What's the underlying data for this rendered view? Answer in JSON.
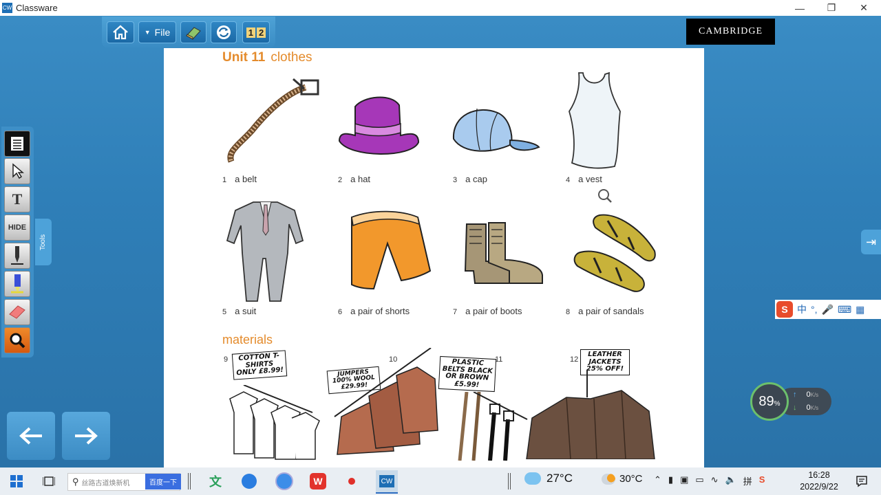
{
  "window": {
    "title": "Classware",
    "icon": "CW"
  },
  "toolbar": {
    "file_label": "File",
    "pages_label_1": "1",
    "pages_label_2": "2"
  },
  "brand": "CAMBRIDGE",
  "page": {
    "title_unit": "Unit 11",
    "title_topic": "clothes",
    "items": [
      {
        "num": "1",
        "label": "a belt"
      },
      {
        "num": "2",
        "label": "a hat"
      },
      {
        "num": "3",
        "label": "a cap"
      },
      {
        "num": "4",
        "label": "a vest"
      },
      {
        "num": "5",
        "label": "a suit"
      },
      {
        "num": "6",
        "label": "a pair of shorts"
      },
      {
        "num": "7",
        "label": "a pair of boots"
      },
      {
        "num": "8",
        "label": "a pair of sandals"
      }
    ],
    "materials_title": "materials",
    "materials": [
      {
        "num": "9",
        "sign": "COTTON T-SHIRTS ONLY £8.99!"
      },
      {
        "num": "10",
        "sign": "JUMPERS 100% WOOL £29.99!"
      },
      {
        "num": "11",
        "sign": "PLASTIC BELTS BLACK OR BROWN £5.99!"
      },
      {
        "num": "12",
        "sign": "LEATHER JACKETS 25% OFF!"
      }
    ]
  },
  "sidebar": {
    "tools_tab": "Tools",
    "hide_label": "HIDE",
    "text_label": "T"
  },
  "ime": {
    "lang": "中",
    "punct": "°,"
  },
  "speed": {
    "percent": "89",
    "unit": "%",
    "up": "0",
    "down": "0",
    "rate_unit": "K/s"
  },
  "taskbar": {
    "search_placeholder": "丝路古道焕新机",
    "search_button": "百度一下",
    "weather_temp": "27°C",
    "weather_temp2": "30°C",
    "time": "16:28",
    "date": "2022/9/22"
  },
  "colors": {
    "accent": "#e48b2c",
    "stage": "#2f7fb8",
    "toolbar": "#3a8cc4"
  }
}
